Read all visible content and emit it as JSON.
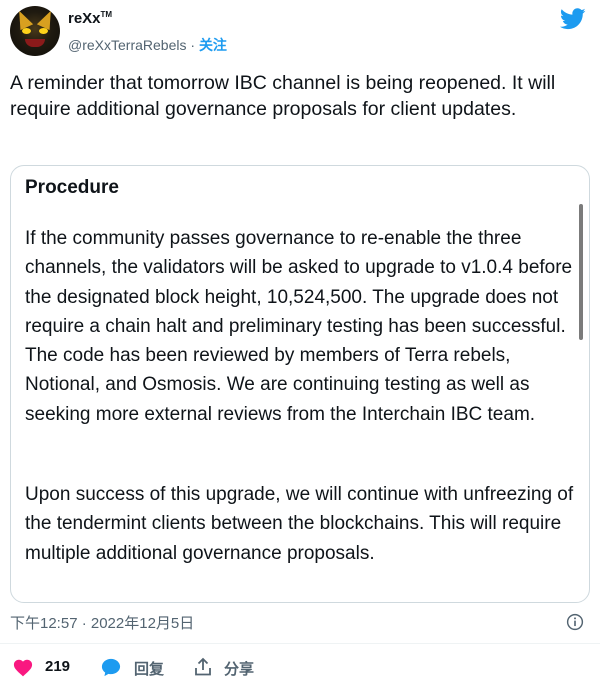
{
  "author": {
    "display_name": "reXx",
    "tm": "TM",
    "handle": "@reXxTerraRebels",
    "separator": " · ",
    "follow_label": "关注"
  },
  "tweet": {
    "text": "A reminder that tomorrow IBC channel is being reopened. It will require additional governance proposals for client updates."
  },
  "card": {
    "title": "Procedure",
    "paragraph1": "If the community passes governance to re-enable the three channels, the validators will be asked to upgrade to v1.0.4 before the designated block height, 10,524,500. The upgrade does not require a chain halt and preliminary testing has been successful. The code has been reviewed by members of Terra rebels, Notional, and Osmosis. We are continuing testing as well as seeking more external reviews from the Interchain IBC team.",
    "paragraph2": "Upon success of this upgrade, we will continue with unfreezing of the tendermint clients between the blockchains. This will require multiple additional governance proposals."
  },
  "meta": {
    "timestamp": "下午12:57 · 2022年12月5日"
  },
  "actions": {
    "likes": "219",
    "reply_label": "回复",
    "share_label": "分享"
  },
  "colors": {
    "accent": "#1d9bf0",
    "like": "#f91880",
    "muted": "#536471"
  },
  "icons": [
    "twitter-bird-icon",
    "info-icon",
    "heart-icon",
    "reply-bubble-icon",
    "share-icon"
  ]
}
